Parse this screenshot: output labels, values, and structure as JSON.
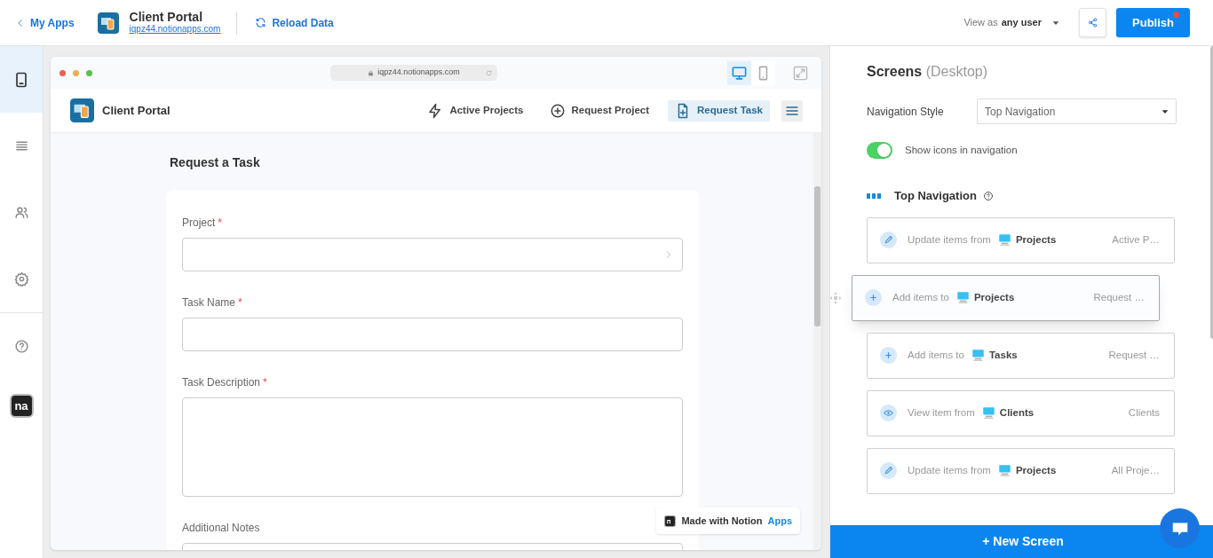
{
  "header": {
    "back_link": "My Apps",
    "app_name": "Client Portal",
    "app_url": "iqpz44.notionapps.com",
    "reload": "Reload Data",
    "view_as_prefix": "View as",
    "view_as_user": "any user",
    "publish": "Publish",
    "unpublished_changes": true
  },
  "rail": {
    "items": [
      {
        "kind": "phone",
        "selected": true
      },
      {
        "kind": "list",
        "selected": false
      },
      {
        "kind": "users",
        "selected": false
      },
      {
        "kind": "settings",
        "selected": false
      },
      {
        "kind": "help",
        "selected": false
      }
    ],
    "logo_text": "na"
  },
  "preview": {
    "url": "iqpz44.notionapps.com",
    "devices": [
      {
        "kind": "desktop",
        "selected": true
      },
      {
        "kind": "mobile",
        "selected": false
      }
    ],
    "app_title": "Client Portal",
    "nav": [
      {
        "kind": "bolt",
        "label": "Active Projects",
        "selected": false
      },
      {
        "kind": "plus-circle",
        "label": "Request Project",
        "selected": false
      },
      {
        "kind": "file-plus",
        "label": "Request Task",
        "selected": true
      }
    ],
    "page_title": "Request a Task",
    "required_mark": "*",
    "fields": [
      {
        "kind": "select",
        "label": "Project",
        "required": true
      },
      {
        "kind": "text",
        "label": "Task Name",
        "required": true
      },
      {
        "kind": "textarea",
        "label": "Task Description",
        "required": true
      },
      {
        "kind": "textarea",
        "label": "Additional Notes",
        "required": false
      }
    ],
    "badge": {
      "prefix": "Made with Notion",
      "accent": "Apps"
    }
  },
  "panel": {
    "title": "Screens",
    "subtitle": "(Desktop)",
    "navigation_style": {
      "label": "Navigation Style",
      "value": "Top Navigation"
    },
    "show_icons": {
      "label": "Show icons in navigation",
      "on": true
    },
    "section": "Top Navigation",
    "screens": [
      {
        "kind": "update",
        "action": "Update items from",
        "source": "Projects",
        "name": "Active P…",
        "dragging": false
      },
      {
        "kind": "add",
        "action": "Add items to",
        "source": "Projects",
        "name": "Request …",
        "dragging": true
      },
      {
        "kind": "add",
        "action": "Add items to",
        "source": "Tasks",
        "name": "Request …",
        "dragging": false
      },
      {
        "kind": "view",
        "action": "View item from",
        "source": "Clients",
        "name": "Clients",
        "dragging": false
      },
      {
        "kind": "update",
        "action": "Update items from",
        "source": "Projects",
        "name": "All Proje…",
        "dragging": false
      }
    ],
    "new_screen": "+ New Screen"
  }
}
